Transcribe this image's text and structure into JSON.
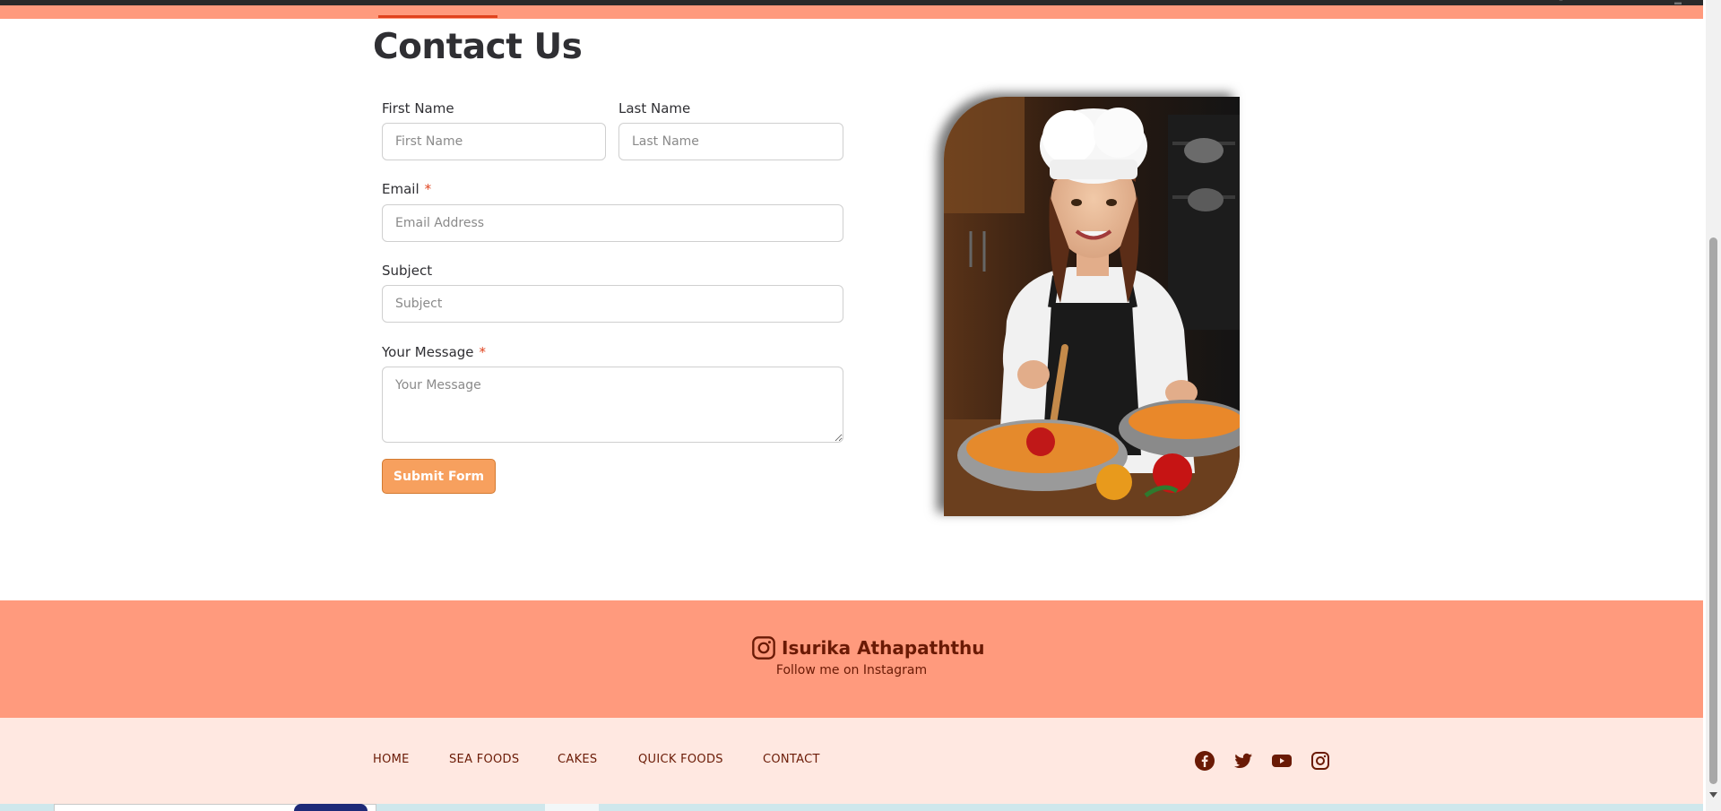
{
  "page": {
    "title": "Contact Us"
  },
  "form": {
    "first_name_label": "First Name",
    "first_name_placeholder": "First Name",
    "last_name_label": "Last Name",
    "last_name_placeholder": "Last Name",
    "email_label": "Email",
    "email_placeholder": "Email Address",
    "subject_label": "Subject",
    "subject_placeholder": "Subject",
    "message_label": "Your Message",
    "message_placeholder": "Your Message",
    "required_mark": "*",
    "submit_label": "Submit Form"
  },
  "instagram": {
    "name": "Isurika Athapaththu",
    "subtitle": "Follow me on Instagram",
    "icon": "instagram-icon"
  },
  "footer_nav": {
    "items": [
      "HOME",
      "SEA FOODS",
      "CAKES",
      "QUICK FOODS",
      "CONTACT"
    ]
  },
  "social_icons": [
    "facebook-icon",
    "twitter-icon",
    "youtube-icon",
    "instagram-icon"
  ],
  "colors": {
    "accent": "#ff9a7d",
    "footer_light": "#ffe8e1",
    "footer_text": "#6a1a05",
    "button": "#f7a05e",
    "required": "#e0431e"
  }
}
